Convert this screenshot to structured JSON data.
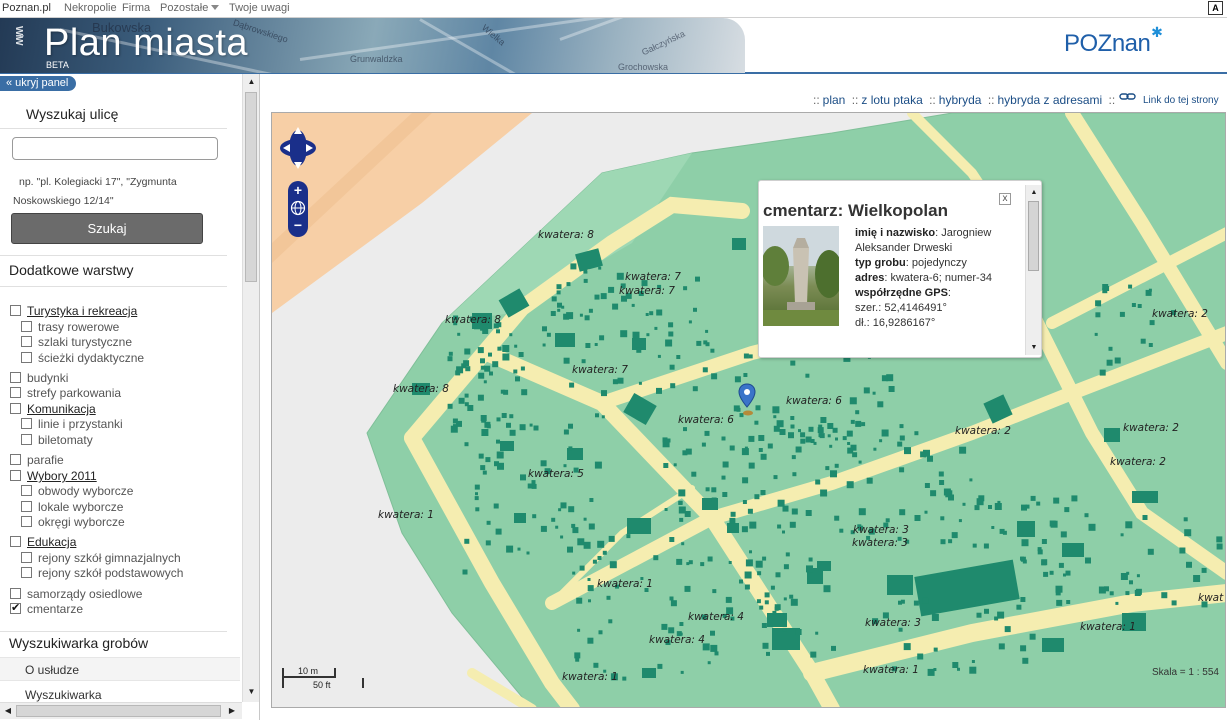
{
  "topnav": {
    "brand": "Poznan.pl",
    "items": [
      "Nekropolie",
      "Firma",
      "Pozostałe",
      "Twoje uwagi"
    ],
    "font_toggle": "A"
  },
  "header": {
    "title": "Plan miasta",
    "beta": "BETA",
    "logo": "POZnan",
    "banner_words": [
      "Bukowska",
      "Dąbrowskiego",
      "Wielka",
      "Grunwaldzka",
      "Gałczyńska",
      "Grochowska"
    ]
  },
  "sidebar": {
    "hide_panel": "« ukryj panel",
    "street_search": {
      "heading": "Wyszukaj ulicę",
      "input_value": "",
      "hint_line1": "np. \"pl. Kolegiacki 17\", \"Zygmunta",
      "hint_line2": "Noskowskiego 12/14\"",
      "button": "Szukaj"
    },
    "layers_heading": "Dodatkowe warstwy",
    "layers": [
      {
        "label": "Turystyka i rekreacja",
        "group": true,
        "checked": false
      },
      {
        "label": "trasy rowerowe",
        "group": false,
        "checked": false
      },
      {
        "label": "szlaki turystyczne",
        "group": false,
        "checked": false
      },
      {
        "label": "ścieżki dydaktyczne",
        "group": false,
        "checked": false
      },
      {
        "label": "budynki",
        "group": false,
        "checked": false
      },
      {
        "label": "strefy parkowania",
        "group": false,
        "checked": false
      },
      {
        "label": "Komunikacja",
        "group": true,
        "checked": false
      },
      {
        "label": "linie i przystanki",
        "group": false,
        "checked": false
      },
      {
        "label": "biletomaty",
        "group": false,
        "checked": false
      },
      {
        "label": "parafie",
        "group": false,
        "checked": false
      },
      {
        "label": "Wybory 2011",
        "group": true,
        "checked": false
      },
      {
        "label": "obwody wyborcze",
        "group": false,
        "checked": false
      },
      {
        "label": "lokale wyborcze",
        "group": false,
        "checked": false
      },
      {
        "label": "okręgi wyborcze",
        "group": false,
        "checked": false
      },
      {
        "label": "Edukacja",
        "group": true,
        "checked": false
      },
      {
        "label": "rejony szkół gimnazjalnych",
        "group": false,
        "checked": false
      },
      {
        "label": "rejony szkół podstawowych",
        "group": false,
        "checked": false
      },
      {
        "label": "samorządy osiedlowe",
        "group": false,
        "checked": false
      },
      {
        "label": "cmentarze",
        "group": false,
        "checked": true
      }
    ],
    "graves_heading": "Wyszukiwarka grobów",
    "graves_links": [
      "O usłudze",
      "Wyszukiwarka"
    ]
  },
  "map_tabs": {
    "items": [
      "plan",
      "z lotu ptaka",
      "hybryda",
      "hybryda z adresami"
    ],
    "separator": "::",
    "permalink": "Link do tej strony"
  },
  "map": {
    "quarter_labels": [
      "kwatera: 8",
      "kwatera: 7",
      "kwatera: 7",
      "kwatera: 8",
      "kwatera: 7",
      "kwatera: 8",
      "kwatera: 6",
      "kwatera: 6",
      "kwatera: 5",
      "kwatera: 1",
      "kwatera: 2",
      "kwatera: 2",
      "kwatera: 2",
      "kwatera: 2",
      "kwatera: 3",
      "kwatera: 3",
      "kwatera: 1",
      "kwatera: 4",
      "kwatera: 4",
      "kwatera: 3",
      "kwatera: 1",
      "kwatera: 1",
      "kwatera: 1",
      "kwat"
    ],
    "zoom_in": "+",
    "zoom_out": "−",
    "scale_metric": "10 m",
    "scale_imperial": "50 ft",
    "scale_ratio": "Skala = 1 : 554",
    "colors": {
      "cemetery": "#8ecfa8",
      "cemetery_light": "#9ed8b4",
      "path": "#f5edb0",
      "grave": "#1f8a6d",
      "background": "#ececec",
      "street": "#f7cfa6"
    }
  },
  "popup": {
    "title": "cmentarz: Wielkopolan",
    "close": "x",
    "fields": [
      {
        "label": "imię i nazwisko",
        "value": ": Jarogniew Aleksander Drweski"
      },
      {
        "label": "typ grobu",
        "value": ": pojedynczy"
      },
      {
        "label": "adres",
        "value": ": kwatera-6; numer-34"
      },
      {
        "label": "współrzędne GPS",
        "value": ":"
      },
      {
        "label": "",
        "value": "szer.: 52,4146491°"
      },
      {
        "label": "",
        "value": "dł.: 16,9286167°"
      }
    ]
  }
}
